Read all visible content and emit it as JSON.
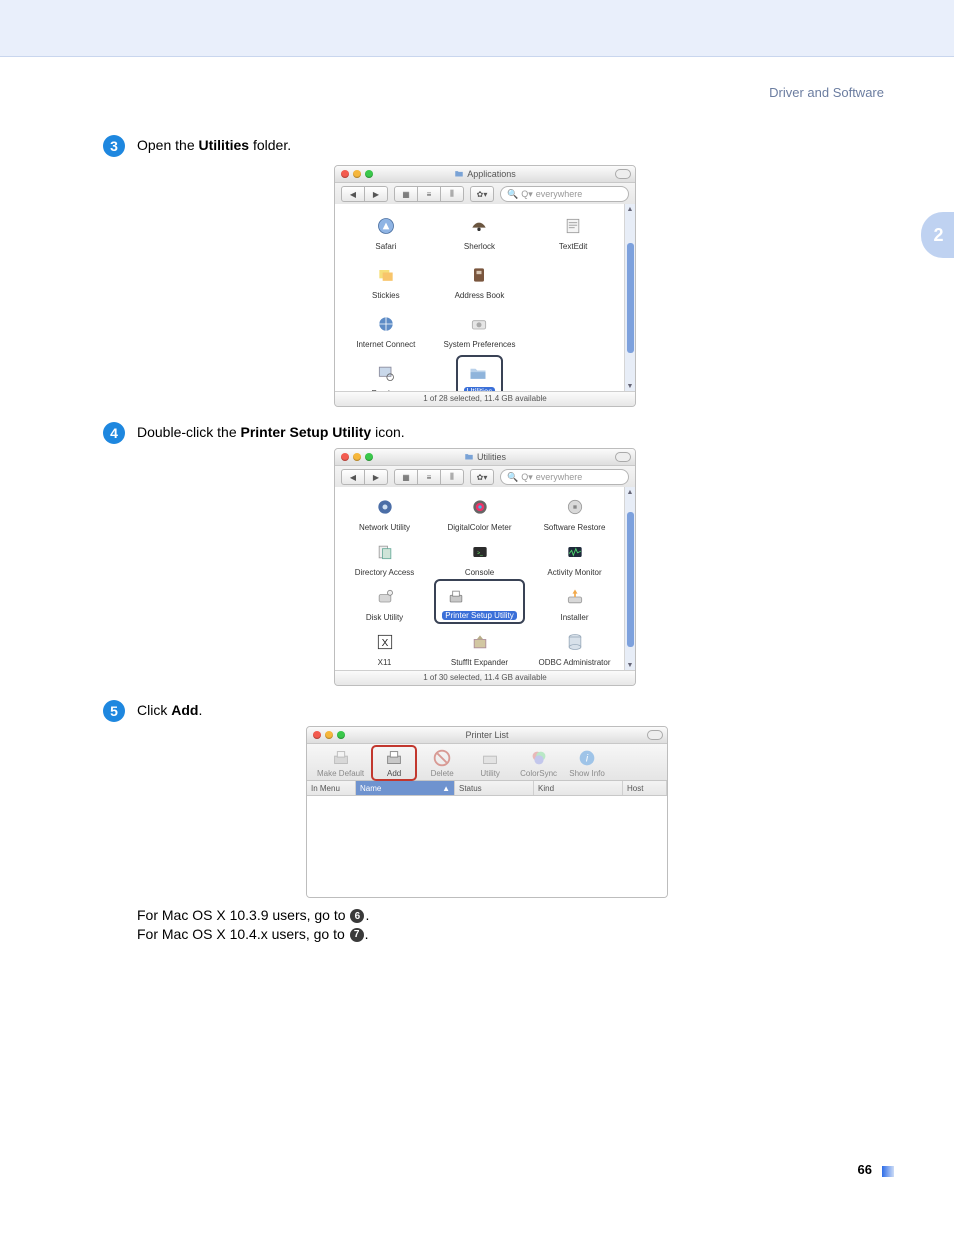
{
  "section_title": "Driver and Software",
  "side_tab": "2",
  "page_number": "66",
  "step3": {
    "num": "3",
    "pre": "Open the ",
    "bold": "Utilities",
    "post": " folder."
  },
  "step4": {
    "num": "4",
    "pre": "Double-click the ",
    "bold": "Printer Setup Utility",
    "post": " icon."
  },
  "step5": {
    "num": "5",
    "pre": "Click ",
    "bold": "Add",
    "post": "."
  },
  "applications_window": {
    "title": "Applications",
    "search_placeholder": "everywhere",
    "status": "1 of 28 selected, 11.4 GB available",
    "items": [
      "Safari",
      "Sherlock",
      "TextEdit",
      "Stickies",
      "Address Book",
      "Internet Connect",
      "System Preferences",
      "Preview",
      "Utilities"
    ],
    "highlight_index": 8
  },
  "utilities_window": {
    "title": "Utilities",
    "search_placeholder": "everywhere",
    "status": "1 of 30 selected, 11.4 GB available",
    "items": [
      "Network Utility",
      "DigitalColor Meter",
      "Software Restore",
      "Directory Access",
      "Console",
      "Activity Monitor",
      "Disk Utility",
      "Printer Setup Utility",
      "Installer",
      "X11",
      "StuffIt Expander",
      "ODBC Administrator"
    ],
    "highlight_index": 7
  },
  "printer_list": {
    "title": "Printer List",
    "buttons": [
      "Make Default",
      "Add",
      "Delete",
      "Utility",
      "ColorSync",
      "Show Info"
    ],
    "highlight_button": 1,
    "columns": [
      "In Menu",
      "Name",
      "Status",
      "Kind",
      "Host"
    ],
    "sort_col": 1
  },
  "notes": {
    "line1_pre": "For Mac OS X 10.3.9 users, go to ",
    "line1_badge": "6",
    "line2_pre": "For Mac OS X 10.4.x users, go to ",
    "line2_badge": "7"
  }
}
